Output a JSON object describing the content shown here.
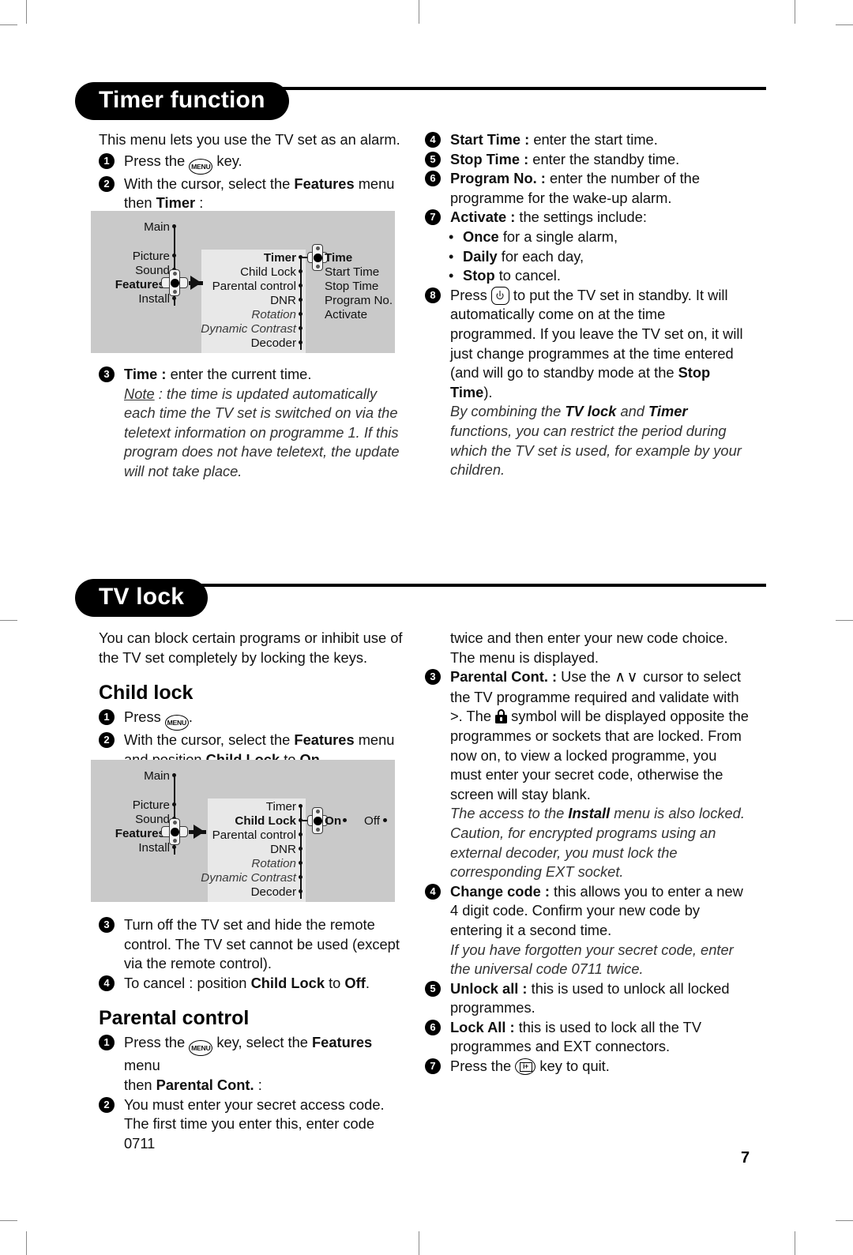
{
  "page": {
    "number": "7"
  },
  "sections": [
    {
      "id": "timer",
      "title": "Timer function",
      "left": {
        "intro": "This menu lets you use the TV set as an alarm.",
        "step1_pre": "Press the",
        "step1_key": "MENU",
        "step1_post": "key.",
        "step2_a": "With the cursor, select the ",
        "step2_b": "Features",
        "step2_c": " menu",
        "step2_d": "then ",
        "step2_e": "Timer",
        "step2_f": " :",
        "step3_bold": "Time :",
        "step3_rest": " enter the current time.",
        "note_label": "Note",
        "note_text": " : the time is updated automatically each time the TV set is switched on via the teletext information on programme 1. If this program does not have teletext, the update will not take place."
      },
      "right": {
        "step4_bold": "Start Time :",
        "step4_rest": " enter the start time.",
        "step5_bold": "Stop Time :",
        "step5_rest": " enter the standby time.",
        "step6_bold": "Program No. :",
        "step6_rest": " enter the number of the programme for the wake-up alarm.",
        "step7_bold": "Activate :",
        "step7_rest": " the settings include:",
        "opt1_bold": "Once",
        "opt1_rest": " for a single alarm,",
        "opt2_bold": "Daily",
        "opt2_rest": " for each day,",
        "opt3_bold": "Stop",
        "opt3_rest": " to cancel.",
        "step8_pre": "Press",
        "step8_key": "standby-icon",
        "step8_post": " to put the TV set in standby. It will automatically come on at the time programmed. If you leave the TV set on, it will just change programmes at the time entered (and will go to standby mode at the ",
        "step8_bold": "Stop Time",
        "step8_end": ").",
        "italic_a": "By combining the ",
        "italic_b": "TV lock",
        "italic_c": " and ",
        "italic_d": "Timer",
        "italic_e": " functions, you can restrict the period during which the TV set is used, for example by your children."
      }
    },
    {
      "id": "tvlock",
      "title": "TV lock",
      "left": {
        "intro": "You can block certain programs or inhibit use of the TV set completely by locking the keys.",
        "child_lock_head": "Child lock",
        "cl_step1_pre": "Press",
        "cl_step1_key": "MENU",
        "cl_step1_post": ".",
        "cl_step2_a": "With the cursor, select the ",
        "cl_step2_b": "Features",
        "cl_step2_c": " menu",
        "cl_step2_d": "and position ",
        "cl_step2_e": "Child Lock",
        "cl_step2_f": " to ",
        "cl_step2_g": "On",
        "cl_step2_h": ".",
        "cl_step3": "Turn off the TV set and hide the remote control. The TV set cannot be used (except via the remote control).",
        "cl_step4_a": "To cancel : position ",
        "cl_step4_b": "Child Lock",
        "cl_step4_c": " to ",
        "cl_step4_d": "Off",
        "cl_step4_e": ".",
        "parental_head": "Parental control",
        "pc_step1_pre": "Press the",
        "pc_step1_key": "MENU",
        "pc_step1_a": " key, select the ",
        "pc_step1_b": "Features",
        "pc_step1_c": " menu",
        "pc_step1_d": "then ",
        "pc_step1_e": "Parental Cont.",
        "pc_step1_f": " :",
        "pc_step2": "You must enter your secret access code. The first time you enter this, enter code 0711"
      },
      "right": {
        "cont_top": "twice and then enter your new code choice. The menu is displayed.",
        "step3_bold": "Parental Cont. :",
        "step3_a": " Use the ",
        "step3_cursor": "∧∨",
        "step3_b": " cursor to select the TV programme required and validate with >. The ",
        "step3_lock": "lock-icon",
        "step3_c": " symbol will be displayed opposite the programmes or sockets that are locked. From now on, to view a locked programme, you must enter your secret code, otherwise the screen will stay blank.",
        "italic3_a": "The access to the ",
        "italic3_b": "Install",
        "italic3_c": " menu is also locked. Caution, for encrypted programs using an external decoder, you must lock the corresponding EXT socket.",
        "step4_bold": "Change code :",
        "step4_rest": " this allows you to enter a new 4 digit code. Confirm your new code by entering it a second time.",
        "italic4": "If you have forgotten your secret code, enter the universal code 0711 twice.",
        "step5_bold": "Unlock all :",
        "step5_rest": " this is used to unlock all locked programmes.",
        "step6_bold": "Lock All :",
        "step6_rest": " this is used to lock all the TV programmes and EXT connectors.",
        "step7_pre": "Press the",
        "step7_key": "i+",
        "step7_post": "key to quit."
      }
    }
  ],
  "diagrams": {
    "timer": {
      "level1": [
        "Main",
        "Picture",
        "Sound",
        "Features",
        "Install"
      ],
      "level1_bold": "Features",
      "level2": [
        "Timer",
        "Child Lock",
        "Parental control",
        "DNR",
        "Rotation",
        "Dynamic Contrast",
        "Decoder"
      ],
      "level2_bold": "Timer",
      "level2_italic": [
        "Rotation",
        "Dynamic Contrast"
      ],
      "level3": [
        "Time",
        "Start Time",
        "Stop Time",
        "Program No.",
        "Activate"
      ],
      "level3_bold": "Time"
    },
    "childlock": {
      "level1": [
        "Main",
        "Picture",
        "Sound",
        "Features",
        "Install"
      ],
      "level1_bold": "Features",
      "level2": [
        "Timer",
        "Child Lock",
        "Parental control",
        "DNR",
        "Rotation",
        "Dynamic Contrast",
        "Decoder"
      ],
      "level2_bold": "Child Lock",
      "level2_italic": [
        "Rotation",
        "Dynamic Contrast"
      ],
      "level3": [
        "On",
        "Off"
      ],
      "level3_bold": "On"
    }
  }
}
